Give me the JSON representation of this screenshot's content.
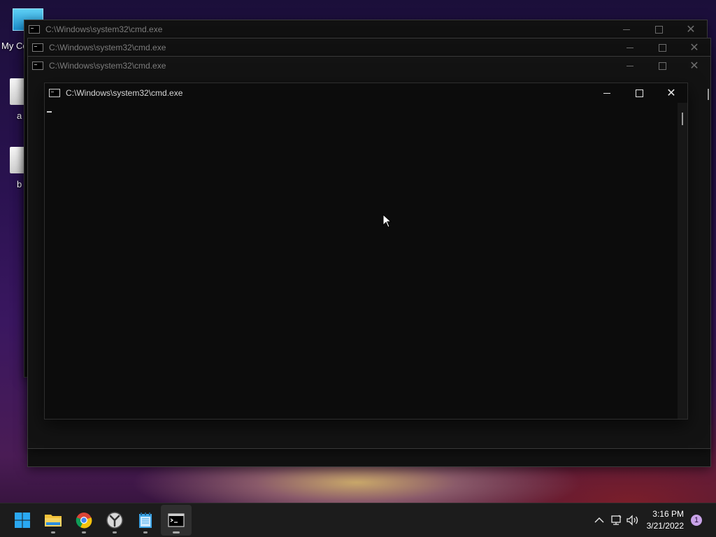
{
  "desktop": {
    "icons": [
      {
        "label": "My Co"
      },
      {
        "label": "a"
      },
      {
        "label": "b"
      }
    ]
  },
  "windows": [
    {
      "title": "C:\\Windows\\system32\\cmd.exe"
    },
    {
      "title": "C:\\Windows\\system32\\cmd.exe"
    },
    {
      "title": "C:\\Windows\\system32\\cmd.exe"
    }
  ],
  "active_window": {
    "title": "C:\\Windows\\system32\\cmd.exe"
  },
  "window_buttons": {
    "minimize": "—",
    "maximize": "☐",
    "close": "✕"
  },
  "taskbar": {
    "apps": [
      {
        "name": "start-icon"
      },
      {
        "name": "file-explorer-icon"
      },
      {
        "name": "chrome-icon"
      },
      {
        "name": "clock-app-icon"
      },
      {
        "name": "notepad-icon"
      },
      {
        "name": "cmd-icon"
      }
    ],
    "tray": {
      "time": "3:16 PM",
      "date": "3/21/2022",
      "notification_count": "1"
    }
  },
  "colors": {
    "taskbar_bg": "#1c1c1c",
    "console_bg": "#0c0c0c",
    "start_blue": "#2aa8f2"
  }
}
